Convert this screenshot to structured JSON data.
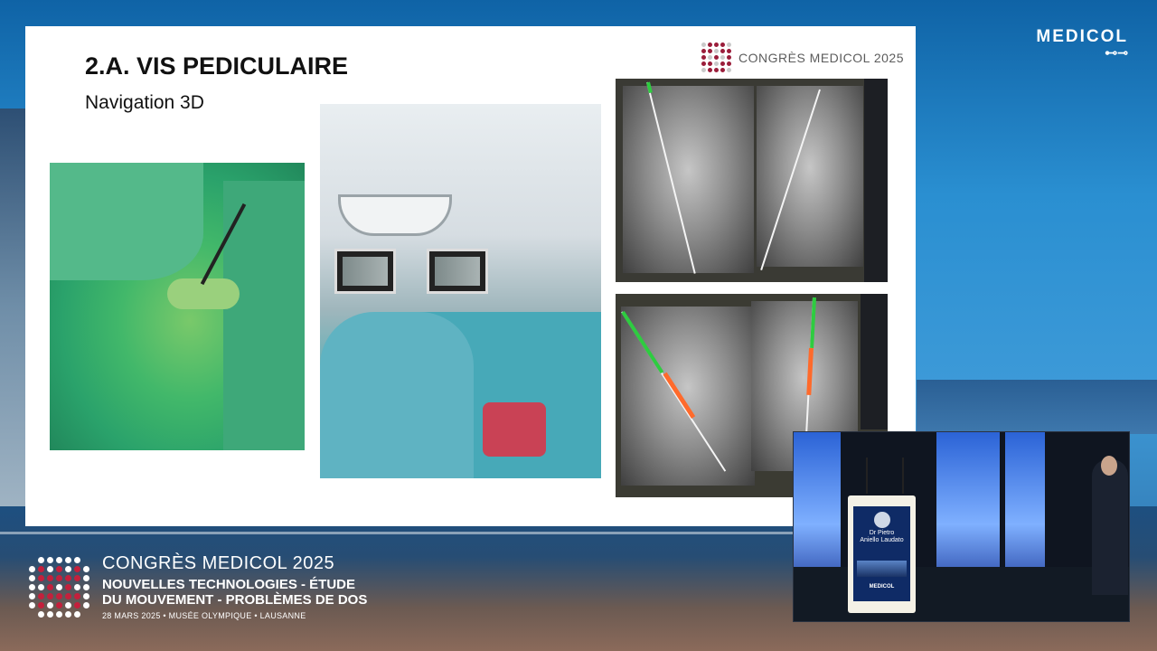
{
  "brand": {
    "top_right_logo": "MEDICOL"
  },
  "slide": {
    "title": "2.A. VIS PEDICULAIRE",
    "subtitle": "Navigation 3D",
    "congress_label": "CONGRÈS MEDICOL 2025"
  },
  "footer": {
    "congress": "CONGRÈS MEDICOL 2025",
    "theme_line1": "NOUVELLES TECHNOLOGIES - ÉTUDE",
    "theme_line2": "DU MOUVEMENT - PROBLÈMES DE DOS",
    "date_place": "28 MARS 2025 • MUSÉE OLYMPIQUE • LAUSANNE"
  },
  "speaker_inset": {
    "podium_name_line1": "Dr Pietro",
    "podium_name_line2": "Aniello Laudato",
    "podium_logo": "MEDICOL"
  },
  "colors": {
    "brand_red": "#9a1d3a",
    "navigation_green": "#2ecc40",
    "screw_orange": "#ff6a2b"
  }
}
